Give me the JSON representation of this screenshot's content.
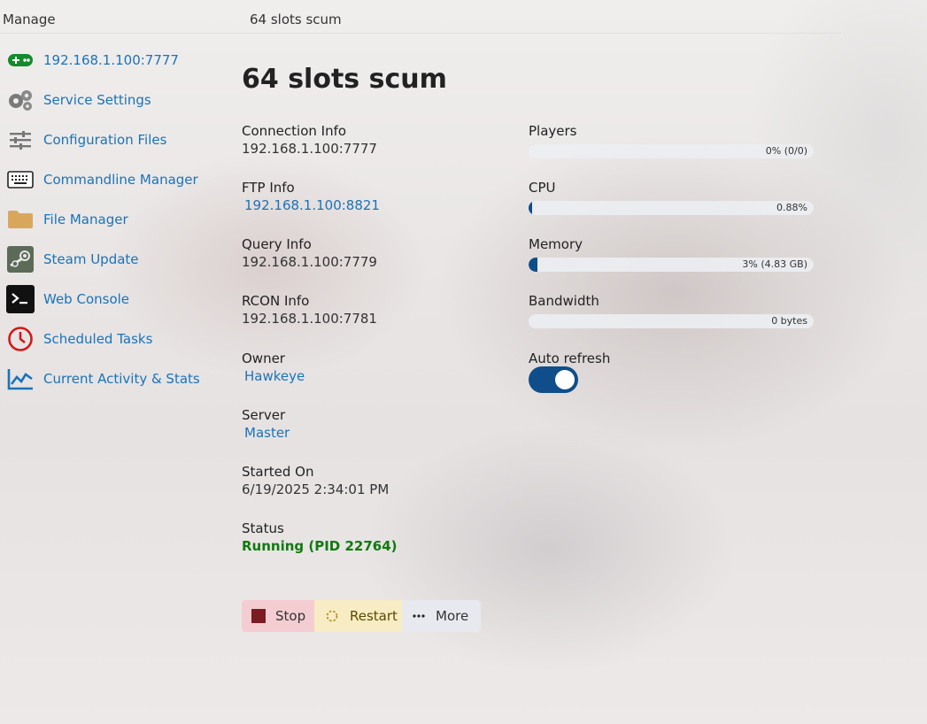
{
  "topbar": {
    "section": "Manage",
    "breadcrumb": "64 slots scum"
  },
  "sidebar": {
    "items": [
      {
        "label": "192.168.1.100:7777",
        "icon": "gamepad-icon"
      },
      {
        "label": "Service Settings",
        "icon": "gears-icon"
      },
      {
        "label": "Configuration Files",
        "icon": "sliders-icon"
      },
      {
        "label": "Commandline Manager",
        "icon": "keyboard-icon"
      },
      {
        "label": "File Manager",
        "icon": "folder-icon"
      },
      {
        "label": "Steam Update",
        "icon": "steam-icon"
      },
      {
        "label": "Web Console",
        "icon": "terminal-icon"
      },
      {
        "label": "Scheduled Tasks",
        "icon": "clock-icon"
      },
      {
        "label": "Current Activity & Stats",
        "icon": "chart-icon"
      }
    ]
  },
  "main": {
    "title": "64 slots scum",
    "connection": {
      "label": "Connection Info",
      "value": "192.168.1.100:7777"
    },
    "ftp": {
      "label": "FTP Info",
      "value": "192.168.1.100:8821"
    },
    "query": {
      "label": "Query Info",
      "value": "192.168.1.100:7779"
    },
    "rcon": {
      "label": "RCON Info",
      "value": "192.168.1.100:7781"
    },
    "owner": {
      "label": "Owner",
      "value": "Hawkeye"
    },
    "server": {
      "label": "Server",
      "value": "Master"
    },
    "started": {
      "label": "Started On",
      "value": "6/19/2025 2:34:01 PM"
    },
    "status": {
      "label": "Status",
      "value": "Running (PID 22764)"
    }
  },
  "metrics": {
    "players": {
      "label": "Players",
      "text": "0% (0/0)",
      "fraction": 0.0
    },
    "cpu": {
      "label": "CPU",
      "text": "0.88%",
      "fraction": 0.0088
    },
    "memory": {
      "label": "Memory",
      "text": "3% (4.83 GB)",
      "fraction": 0.03
    },
    "bandwidth": {
      "label": "Bandwidth",
      "text": "0 bytes",
      "fraction": 0.0
    }
  },
  "auto_refresh": {
    "label": "Auto refresh",
    "enabled": true
  },
  "actions": {
    "stop": "Stop",
    "restart": "Restart",
    "more": "More"
  },
  "colors": {
    "accent": "#0f4e8a",
    "link": "#1a73b8",
    "status_running": "#0f7a0f"
  }
}
